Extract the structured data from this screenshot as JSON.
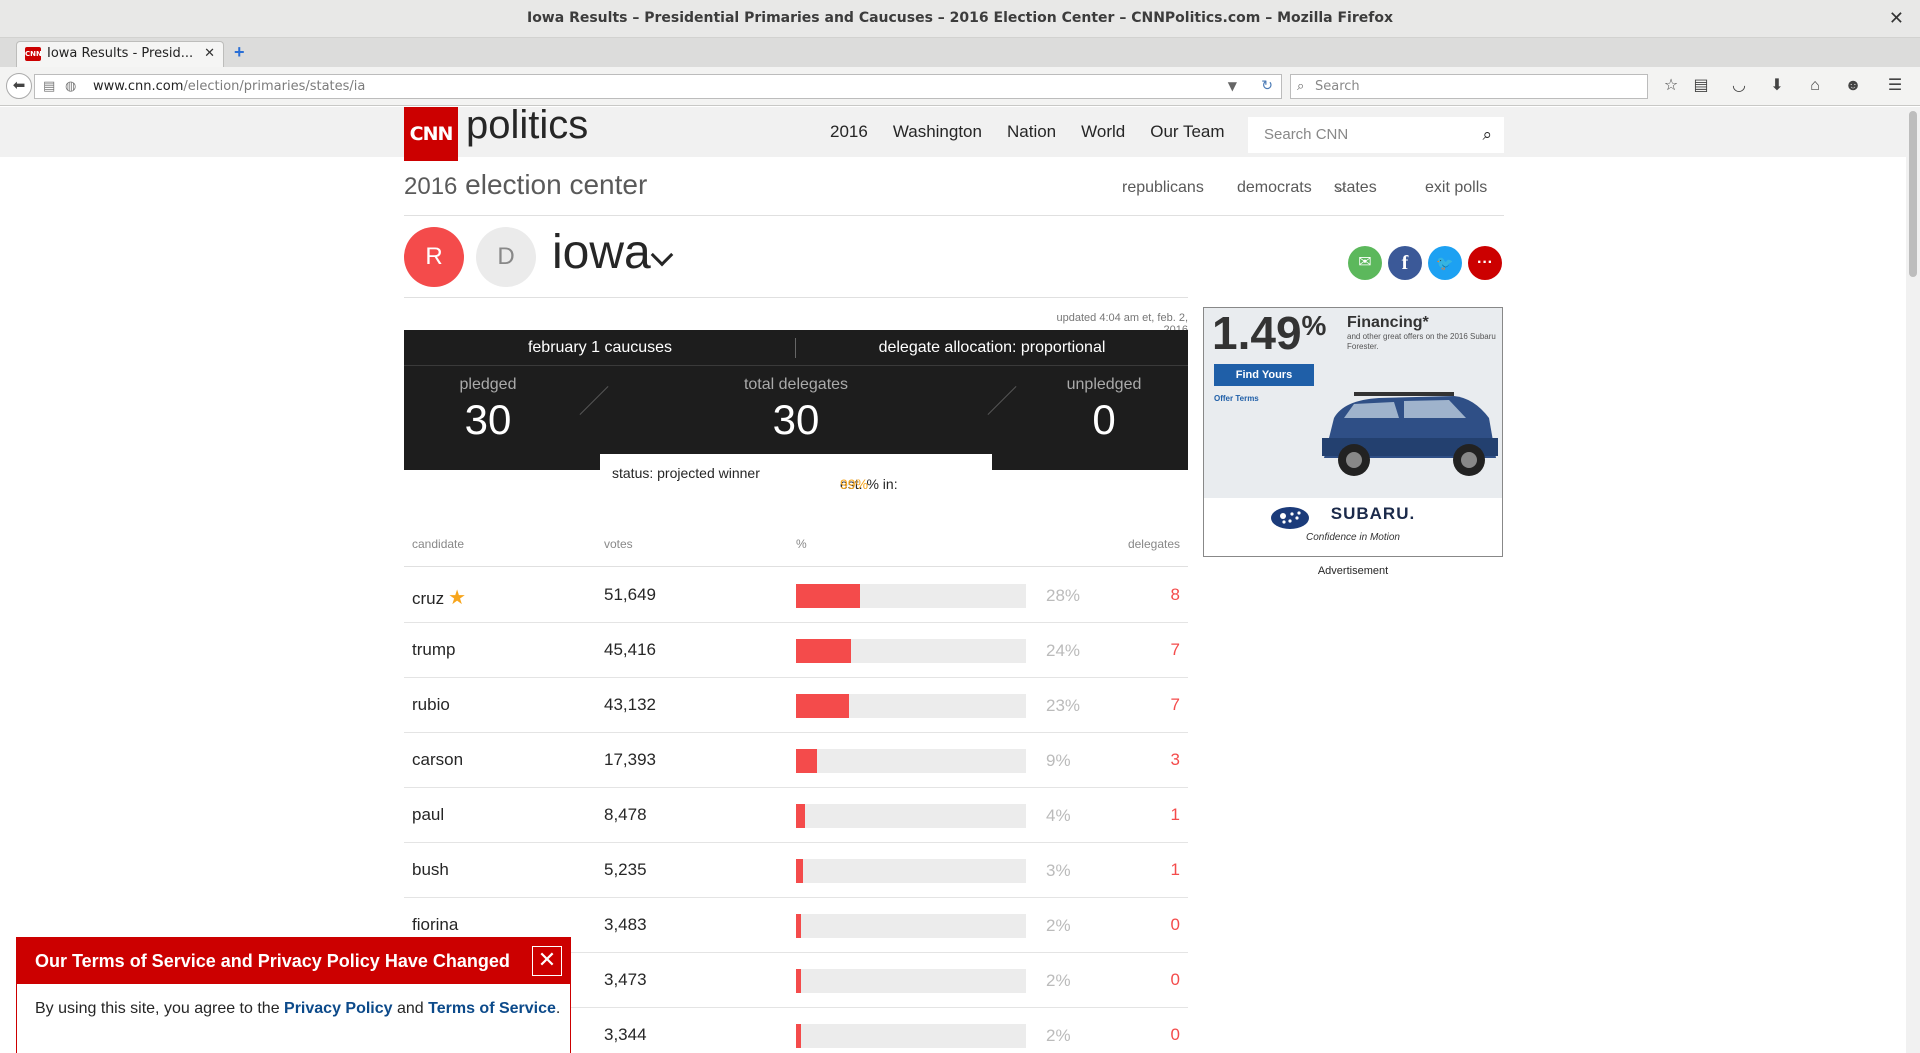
{
  "browser": {
    "window_title": "Iowa Results – Presidential Primaries and Caucuses – 2016 Election Center – CNNPolitics.com – Mozilla Firefox",
    "tab_title": "Iowa Results - Presid...",
    "favicon_text": "CNN",
    "url_host": "www.cnn.com",
    "url_path": "/election/primaries/states/ia",
    "search_placeholder": "Search"
  },
  "header": {
    "logo_text": "CNN",
    "section": "politics",
    "nav": [
      "2016",
      "Washington",
      "Nation",
      "World",
      "Our Team"
    ],
    "search_placeholder": "Search CNN"
  },
  "election": {
    "year": "2016",
    "title": "election center",
    "subnav": [
      "republicans",
      "democrats",
      "states",
      "exit polls"
    ]
  },
  "state": {
    "party_r": "R",
    "party_d": "D",
    "name": "iowa"
  },
  "results": {
    "updated": "updated 4:04 am et, feb. 2, 2016",
    "event": "february 1 caucuses",
    "allocation": "delegate allocation: proportional",
    "pledged_label": "pledged",
    "pledged": "30",
    "total_label": "total delegates",
    "total": "30",
    "unpledged_label": "unpledged",
    "unpledged": "0",
    "status": "status: projected winner",
    "est_label": "est. % in:",
    "est_value": "99%"
  },
  "table": {
    "headers": {
      "candidate": "candidate",
      "votes": "votes",
      "pct": "%",
      "delegates": "delegates"
    },
    "rows": [
      {
        "name": "cruz",
        "votes": "51,649",
        "pct": "28%",
        "share": 28,
        "delegates": "8",
        "winner": true
      },
      {
        "name": "trump",
        "votes": "45,416",
        "pct": "24%",
        "share": 24,
        "delegates": "7"
      },
      {
        "name": "rubio",
        "votes": "43,132",
        "pct": "23%",
        "share": 23,
        "delegates": "7"
      },
      {
        "name": "carson",
        "votes": "17,393",
        "pct": "9%",
        "share": 9,
        "delegates": "3"
      },
      {
        "name": "paul",
        "votes": "8,478",
        "pct": "4%",
        "share": 4,
        "delegates": "1"
      },
      {
        "name": "bush",
        "votes": "5,235",
        "pct": "3%",
        "share": 3,
        "delegates": "1"
      },
      {
        "name": "fiorina",
        "votes": "3,483",
        "pct": "2%",
        "share": 2,
        "delegates": "0"
      },
      {
        "name": "",
        "votes": "3,473",
        "pct": "2%",
        "share": 2,
        "delegates": "0"
      },
      {
        "name": "",
        "votes": "3,344",
        "pct": "2%",
        "share": 2,
        "delegates": "0"
      }
    ]
  },
  "ad": {
    "rate": "1.49",
    "rate_suffix": "%",
    "headline": "Financing*",
    "fine_print": "and other great offers on the 2016 Subaru Forester.",
    "cta": "Find Yours",
    "offer": "Offer Terms",
    "brand": "SUBARU.",
    "tagline": "Confidence in Motion",
    "label": "Advertisement"
  },
  "tos": {
    "title": "Our Terms of Service and Privacy Policy Have Changed",
    "body_prefix": "By using this site, you agree to the ",
    "privacy_link": "Privacy Policy",
    "and": " and ",
    "terms_link": "Terms of Service",
    "body_suffix": "."
  },
  "colors": {
    "cnn_red": "#cc0000",
    "republican_red": "#f44b4b",
    "estimate_orange": "#f7a51c",
    "email_green": "#5cb85c",
    "facebook_blue": "#3b5998",
    "twitter_blue": "#1da1f2"
  }
}
